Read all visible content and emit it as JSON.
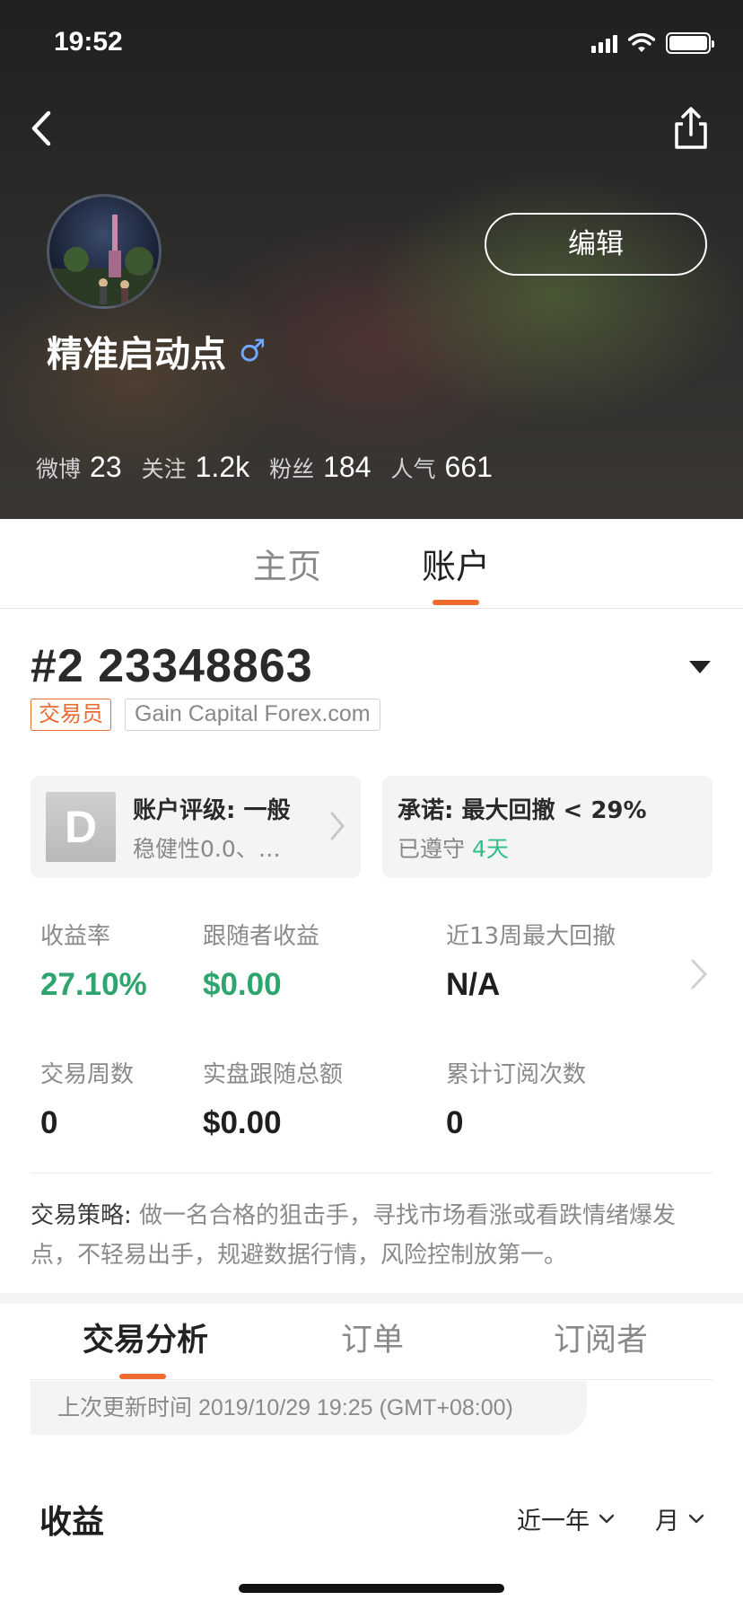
{
  "status_bar": {
    "time": "19:52"
  },
  "profile": {
    "username": "精准启动点",
    "gender_symbol": "♂",
    "edit_label": "编辑",
    "stats": [
      {
        "label": "微博",
        "value": "23"
      },
      {
        "label": "关注",
        "value": "1.2k"
      },
      {
        "label": "粉丝",
        "value": "184"
      },
      {
        "label": "人气",
        "value": "661"
      }
    ]
  },
  "main_tabs": [
    {
      "label": "主页",
      "active": false
    },
    {
      "label": "账户",
      "active": true
    }
  ],
  "account": {
    "number": "#2 23348863",
    "role_tag": "交易员",
    "broker_tag": "Gain Capital Forex.com",
    "rating": {
      "grade": "D",
      "title": "账户评级: 一般",
      "subtitle": "稳健性0.0、…"
    },
    "promise": {
      "title": "承诺: 最大回撤 < 29%",
      "kept_prefix": "已遵守",
      "kept_days": "4天"
    },
    "metrics": [
      {
        "label": "收益率",
        "value": "27.10%",
        "highlight": "green"
      },
      {
        "label": "跟随者收益",
        "value": "$0.00",
        "highlight": "green"
      },
      {
        "label": "近13周最大回撤",
        "value": "N/A",
        "highlight": "none"
      },
      {
        "label": "交易周数",
        "value": "0",
        "highlight": "none"
      },
      {
        "label": "实盘跟随总额",
        "value": "$0.00",
        "highlight": "none"
      },
      {
        "label": "累计订阅次数",
        "value": "0",
        "highlight": "none"
      }
    ],
    "strategy_label": "交易策略:",
    "strategy_text": " 做一名合格的狙击手，寻找市场看涨或看跌情绪爆发点，不轻易出手，规避数据行情，风险控制放第一。"
  },
  "sub_tabs": [
    {
      "label": "交易分析",
      "active": true
    },
    {
      "label": "订单",
      "active": false
    },
    {
      "label": "订阅者",
      "active": false
    }
  ],
  "analysis": {
    "last_update": "上次更新时间 2019/10/29 19:25 (GMT+08:00)",
    "income_title": "收益",
    "period_filter": "近一年",
    "granularity_filter": "月"
  },
  "colors": {
    "accent": "#ee6a2f",
    "positive": "#2ea56f",
    "promise_days": "#2fbf88"
  }
}
